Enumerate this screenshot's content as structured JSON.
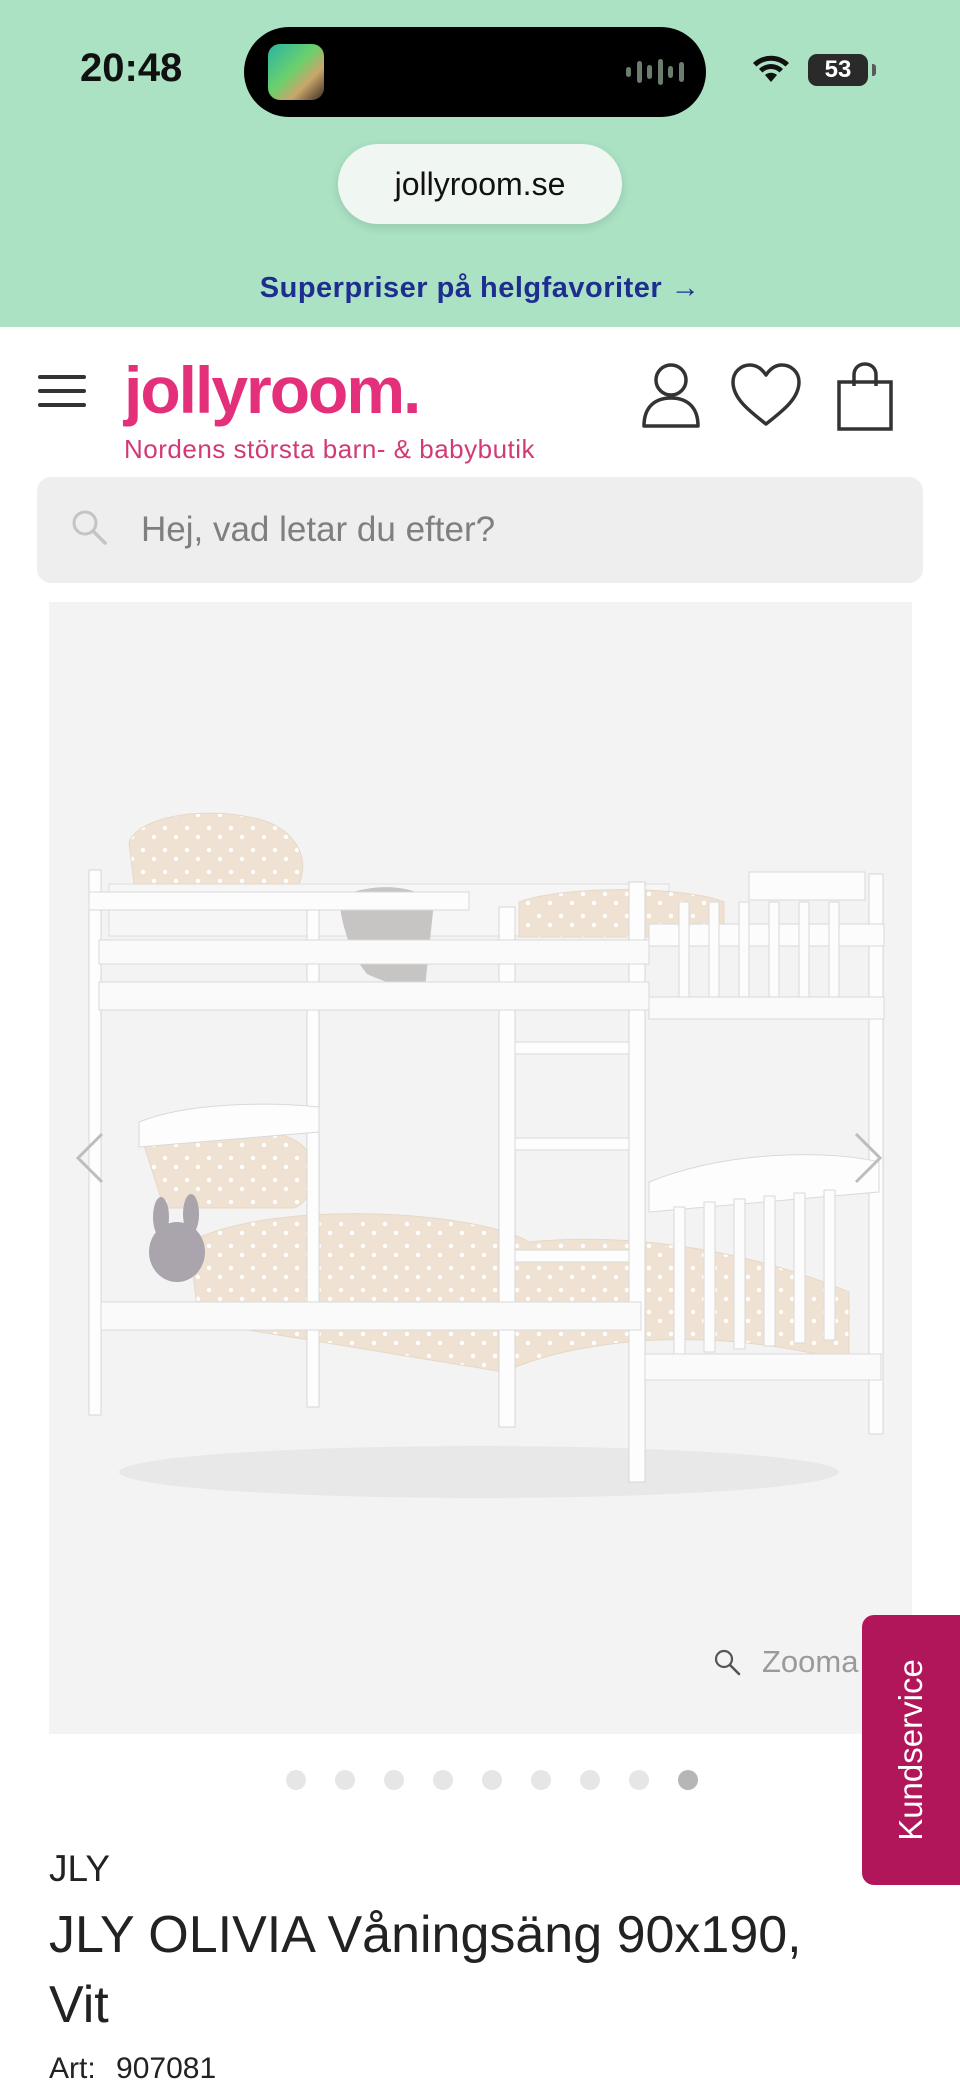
{
  "status_bar": {
    "time": "20:48",
    "battery": "53"
  },
  "browser": {
    "url": "jollyroom.se"
  },
  "promo_banner": {
    "text": "Superpriser på helgfavoriter →"
  },
  "header": {
    "logo": "jollyroom.",
    "tagline": "Nordens största barn- & babybutik",
    "icons": [
      "menu-icon",
      "user-icon",
      "heart-icon",
      "cart-icon"
    ]
  },
  "search": {
    "placeholder": "Hej, vad letar du efter?"
  },
  "gallery": {
    "image_count": 9,
    "active_index": 8,
    "zoom_label": "Zooma"
  },
  "kundservice": {
    "label": "Kundservice"
  },
  "product": {
    "brand": "JLY",
    "title": "JLY OLIVIA Våningsäng 90x190, Vit",
    "art_label": "Art:",
    "art_number": "907081"
  },
  "colors": {
    "topbar_bg": "#abe2c4",
    "brand_pink": "#e4307b",
    "promo_text": "#1d2e8e",
    "kundservice_bg": "#b1165b"
  }
}
